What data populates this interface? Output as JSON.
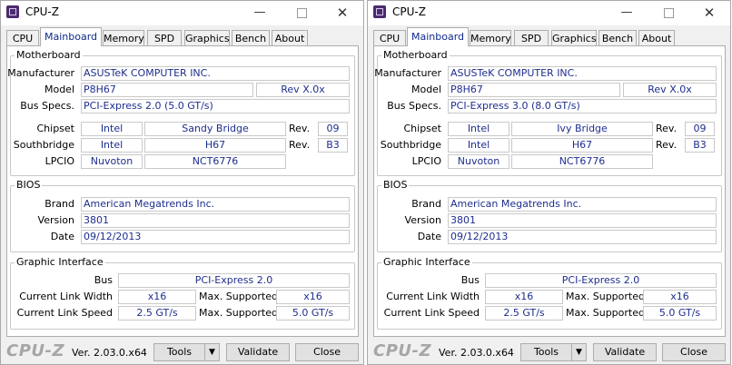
{
  "windows": [
    {
      "title": "CPU-Z",
      "tabs": [
        "CPU",
        "Mainboard",
        "Memory",
        "SPD",
        "Graphics",
        "Bench",
        "About"
      ],
      "active_tab": "Mainboard",
      "motherboard": {
        "group_title": "Motherboard",
        "manufacturer_label": "Manufacturer",
        "manufacturer": "ASUSTeK COMPUTER INC.",
        "model_label": "Model",
        "model": "P8H67",
        "model_rev": "Rev X.0x",
        "bus_specs_label": "Bus Specs.",
        "bus_specs": "PCI-Express 2.0 (5.0 GT/s)",
        "chipset_label": "Chipset",
        "chipset_vendor": "Intel",
        "chipset_name": "Sandy Bridge",
        "rev_label": "Rev.",
        "chipset_rev": "09",
        "southbridge_label": "Southbridge",
        "southbridge_vendor": "Intel",
        "southbridge_name": "H67",
        "southbridge_rev": "B3",
        "lpcio_label": "LPCIO",
        "lpcio_vendor": "Nuvoton",
        "lpcio_name": "NCT6776"
      },
      "bios": {
        "group_title": "BIOS",
        "brand_label": "Brand",
        "brand": "American Megatrends Inc.",
        "version_label": "Version",
        "version": "3801",
        "date_label": "Date",
        "date": "09/12/2013"
      },
      "graphic_interface": {
        "group_title": "Graphic Interface",
        "bus_label": "Bus",
        "bus": "PCI-Express 2.0",
        "link_width_label": "Current Link Width",
        "link_width": "x16",
        "max_supported_label": "Max. Supported",
        "max_width": "x16",
        "link_speed_label": "Current Link Speed",
        "link_speed": "2.5 GT/s",
        "max_speed": "5.0 GT/s"
      },
      "footer": {
        "logo": "CPU-Z",
        "version": "Ver. 2.03.0.x64",
        "tools_label": "Tools",
        "validate_label": "Validate",
        "close_label": "Close"
      }
    },
    {
      "title": "CPU-Z",
      "tabs": [
        "CPU",
        "Mainboard",
        "Memory",
        "SPD",
        "Graphics",
        "Bench",
        "About"
      ],
      "active_tab": "Mainboard",
      "motherboard": {
        "group_title": "Motherboard",
        "manufacturer_label": "Manufacturer",
        "manufacturer": "ASUSTeK COMPUTER INC.",
        "model_label": "Model",
        "model": "P8H67",
        "model_rev": "Rev X.0x",
        "bus_specs_label": "Bus Specs.",
        "bus_specs": "PCI-Express 3.0 (8.0 GT/s)",
        "chipset_label": "Chipset",
        "chipset_vendor": "Intel",
        "chipset_name": "Ivy Bridge",
        "rev_label": "Rev.",
        "chipset_rev": "09",
        "southbridge_label": "Southbridge",
        "southbridge_vendor": "Intel",
        "southbridge_name": "H67",
        "southbridge_rev": "B3",
        "lpcio_label": "LPCIO",
        "lpcio_vendor": "Nuvoton",
        "lpcio_name": "NCT6776"
      },
      "bios": {
        "group_title": "BIOS",
        "brand_label": "Brand",
        "brand": "American Megatrends Inc.",
        "version_label": "Version",
        "version": "3801",
        "date_label": "Date",
        "date": "09/12/2013"
      },
      "graphic_interface": {
        "group_title": "Graphic Interface",
        "bus_label": "Bus",
        "bus": "PCI-Express 2.0",
        "link_width_label": "Current Link Width",
        "link_width": "x16",
        "max_supported_label": "Max. Supported",
        "max_width": "x16",
        "link_speed_label": "Current Link Speed",
        "link_speed": "2.5 GT/s",
        "max_speed": "5.0 GT/s"
      },
      "footer": {
        "logo": "CPU-Z",
        "version": "Ver. 2.03.0.x64",
        "tools_label": "Tools",
        "validate_label": "Validate",
        "close_label": "Close"
      }
    }
  ],
  "icons": {
    "app": "cpu-z-app-icon",
    "minimize": "minimize-icon",
    "maximize": "maximize-icon",
    "close": "close-icon",
    "dropdown": "caret-down-icon"
  },
  "colors": {
    "value_text": "#1e2e8e",
    "active_tab_text": "#0d2a8a",
    "window_bg": "#f0f0f0",
    "logo": "#a6a6a6"
  }
}
